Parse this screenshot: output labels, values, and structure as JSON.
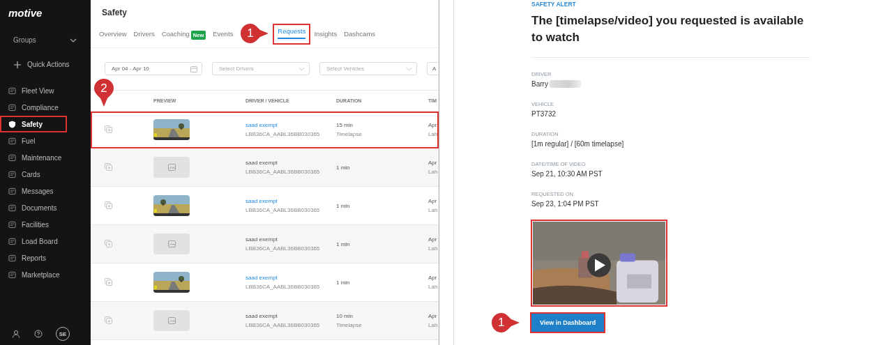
{
  "sidebar": {
    "logo": "motive",
    "groups": {
      "label": "Groups"
    },
    "quick_actions": {
      "label": "Quick Actions"
    },
    "items": [
      {
        "label": "Fleet View",
        "selected": false,
        "highlighted": false
      },
      {
        "label": "Compliance",
        "selected": false,
        "highlighted": false
      },
      {
        "label": "Safety",
        "selected": true,
        "highlighted": true
      },
      {
        "label": "Fuel",
        "selected": false,
        "highlighted": false
      },
      {
        "label": "Maintenance",
        "selected": false,
        "highlighted": false
      },
      {
        "label": "Cards",
        "selected": false,
        "highlighted": false
      },
      {
        "label": "Messages",
        "selected": false,
        "highlighted": false
      },
      {
        "label": "Documents",
        "selected": false,
        "highlighted": false
      },
      {
        "label": "Facilities",
        "selected": false,
        "highlighted": false
      },
      {
        "label": "Load Board",
        "selected": false,
        "highlighted": false
      },
      {
        "label": "Reports",
        "selected": false,
        "highlighted": false
      },
      {
        "label": "Marketplace",
        "selected": false,
        "highlighted": false
      }
    ],
    "avatar": "SE"
  },
  "page": {
    "title": "Safety"
  },
  "tabs": [
    {
      "label": "Overview",
      "selected": false,
      "highlighted": false
    },
    {
      "label": "Drivers",
      "selected": false,
      "highlighted": false
    },
    {
      "label": "Coaching",
      "badge": "New",
      "selected": false,
      "highlighted": false
    },
    {
      "label": "Events",
      "selected": false,
      "highlighted": false
    },
    {
      "label": "Requests",
      "selected": true,
      "highlighted": true,
      "callout": "1"
    },
    {
      "label": "Insights",
      "selected": false,
      "highlighted": false
    },
    {
      "label": "Dashcams",
      "selected": false,
      "highlighted": false
    }
  ],
  "filters": [
    {
      "kind": "date",
      "value": "Apr 04 - Apr 10"
    },
    {
      "kind": "select",
      "placeholder": "Select Drivers"
    },
    {
      "kind": "select",
      "placeholder": "Select Vehicles"
    },
    {
      "kind": "select",
      "value": "A"
    }
  ],
  "table": {
    "columns": [
      "PREVIEW",
      "DRIVER / VEHICLE",
      "DURATION",
      "TIM"
    ],
    "rows": [
      {
        "kind": "video",
        "driver": "saad exempt",
        "vehicle": "LBB36CA_AABL36BB030365",
        "duration": "15 min",
        "duration_type": "Timelapse",
        "column_5": [
          "Apr",
          "Lah"
        ],
        "highlighted": true,
        "callout": "2"
      },
      {
        "kind": "no_preview",
        "driver": "saad exempt",
        "vehicle": "LBB36CA_AABL36BB030365",
        "duration": "1 min",
        "column_5": [
          "Apr",
          "Lah"
        ],
        "highlighted": false
      },
      {
        "kind": "video",
        "driver": "saad exempt",
        "vehicle": "LBB36CA_AABL36BB030365",
        "duration": "1 min",
        "column_5": [
          "Apr",
          "Lah"
        ],
        "highlighted": false
      },
      {
        "kind": "no_preview",
        "driver": "saad exempt",
        "vehicle": "LBB36CA_AABL36BB030365",
        "duration": "1 min",
        "column_5": [
          "Apr",
          "Lah"
        ],
        "highlighted": false
      },
      {
        "kind": "video",
        "driver": "saad exempt",
        "vehicle": "LBB36CA_AABL36BB030365",
        "duration": "1 min",
        "column_5": [
          "Apr",
          "Lah"
        ],
        "highlighted": false
      },
      {
        "kind": "no_preview",
        "driver": "saad exempt",
        "vehicle": "LBB36CA_AABL36BB030365",
        "duration": "10 min",
        "duration_type": "Timelapse",
        "column_5": [
          "Apr",
          "Lah"
        ],
        "highlighted": false
      }
    ]
  },
  "alert": {
    "eyebrow": "SAFETY ALERT",
    "heading": "The [timelapse/video] you requested is available to watch",
    "fields": [
      {
        "label": "DRIVER",
        "value": "Barry",
        "redacted": true
      },
      {
        "label": "VEHICLE",
        "value": "PT3732",
        "redacted": false
      },
      {
        "label": "DURATION",
        "value": "[1m regular] / [60m timelapse]",
        "redacted": false
      },
      {
        "label": "DATE/TIME OF VIDEO",
        "value": "Sep 21, 10:30 AM PST",
        "redacted": false
      },
      {
        "label": "REQUESTED ON",
        "value": "Sep 23, 1:04 PM PST",
        "redacted": false
      }
    ],
    "video": {
      "highlighted": true
    },
    "button": {
      "label": "View in Dashboard",
      "highlighted": true,
      "callout": "1"
    }
  }
}
